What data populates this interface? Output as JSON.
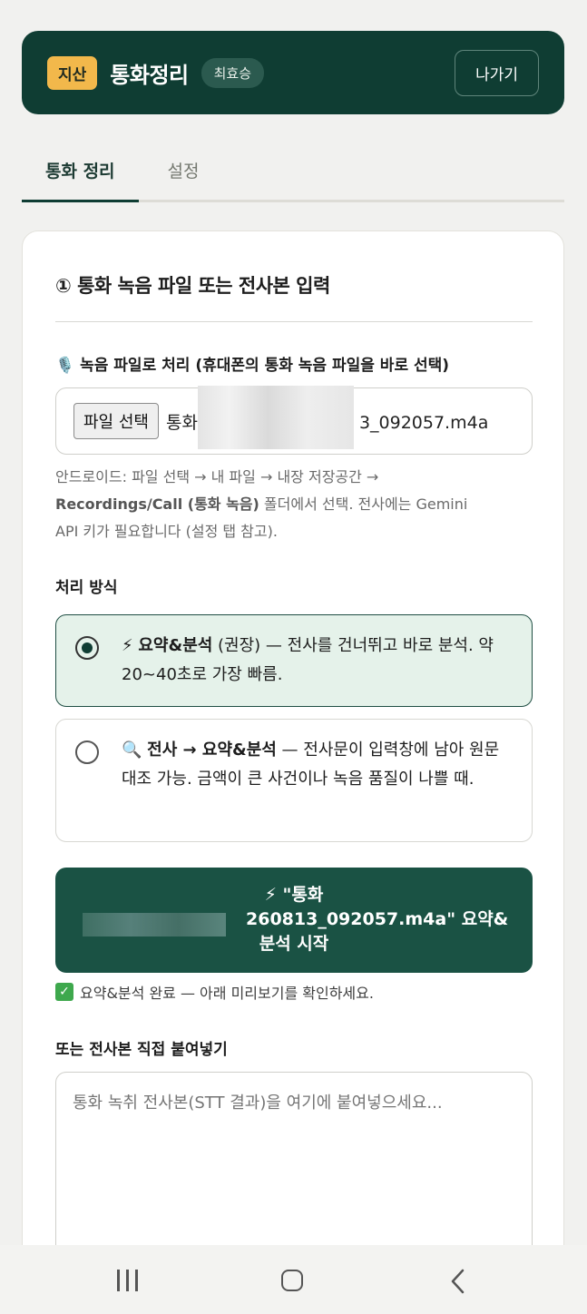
{
  "header": {
    "org_badge": "지산",
    "title": "통화정리",
    "user": "최효승",
    "exit_label": "나가기"
  },
  "tabs": [
    {
      "label": "통화 정리",
      "active": true
    },
    {
      "label": "설정",
      "active": false
    }
  ],
  "card": {
    "section_title": "① 통화 녹음 파일 또는 전사본 입력",
    "file_label": "🎙️ 녹음 파일로 처리 (휴대폰의 통화 녹음 파일을 바로 선택)",
    "file_button": "파일 선택",
    "file_name_prefix": "통화",
    "file_name_suffix": "3_092057.m4a",
    "help_line1": "안드로이드: 파일 선택 → 내 파일 → 내장 저장공간 →",
    "help_bold": "Recordings/Call (통화 녹음)",
    "help_line2_rest": " 폴더에서 선택. 전사에는 Gemini",
    "help_line3": "API 키가 필요합니다 (설정 탭 참고).",
    "method_label": "처리 방식",
    "option1": {
      "icon": "⚡",
      "title": "요약&분석",
      "text": " (권장) — 전사를 건너뛰고 바로 분석. 약 20~40초로 가장 빠름.",
      "selected": true
    },
    "option2": {
      "icon": "🔍",
      "title": "전사 → 요약&분석",
      "text": " — 전사문이 입력창에 남아 원문 대조 가능. 금액이 큰 사건이나 녹음 품질이 나쁠 때.",
      "selected": false
    },
    "start_button_line1": "⚡ \"통화",
    "start_button_line2": "260813_092057.m4a\" 요약&",
    "start_button_line3": "분석 시작",
    "done_message": "요약&분석 완료 — 아래 미리보기를 확인하세요.",
    "paste_label": "또는 전사본 직접 붙여넣기",
    "paste_placeholder": "통화 녹취 전사본(STT 결과)을 여기에 붙여넣으세요..."
  },
  "colors": {
    "primary": "#0f3d33",
    "accent": "#f2b84b",
    "selected_bg": "#e5f2ea"
  }
}
